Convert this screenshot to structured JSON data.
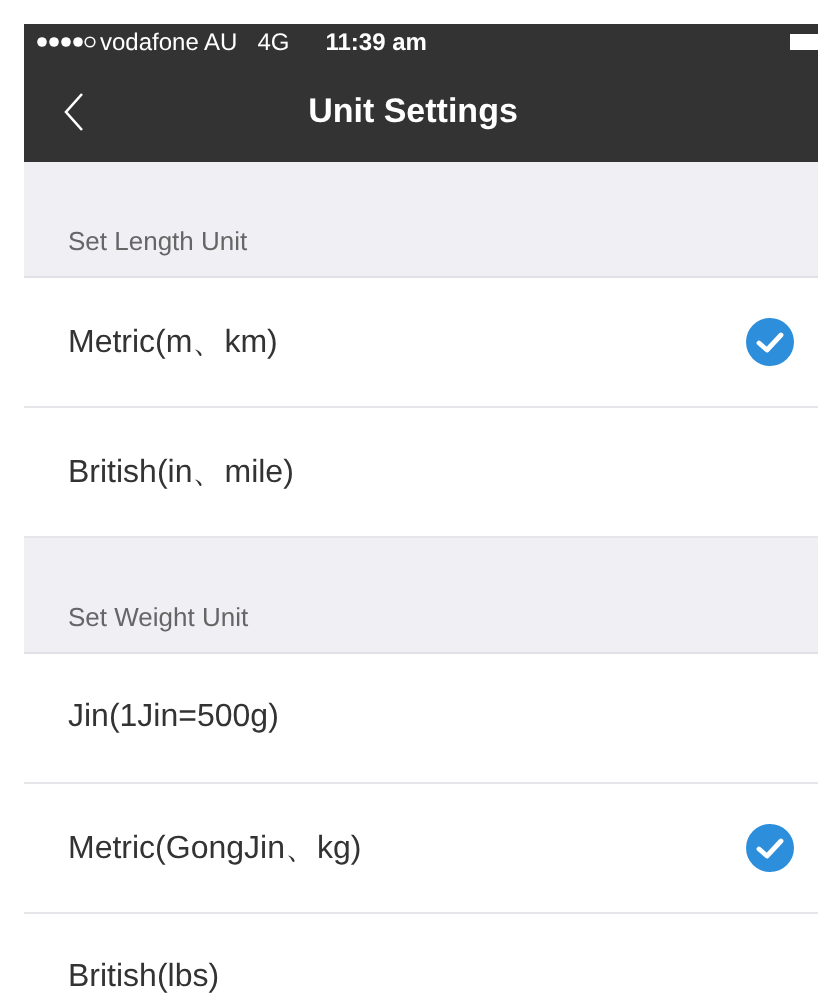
{
  "status_bar": {
    "carrier": "vodafone AU",
    "network": "4G",
    "time": "11:39 am"
  },
  "nav_bar": {
    "title": "Unit Settings"
  },
  "sections": [
    {
      "header": "Set Length Unit",
      "options": [
        {
          "label": "Metric(m、km)",
          "selected": true
        },
        {
          "label": "British(in、mile)",
          "selected": false
        }
      ]
    },
    {
      "header": "Set Weight Unit",
      "options": [
        {
          "label": "Jin(1Jin=500g)",
          "selected": false
        },
        {
          "label": "Metric(GongJin、kg)",
          "selected": true
        },
        {
          "label": "British(lbs)",
          "selected": false
        }
      ]
    }
  ]
}
